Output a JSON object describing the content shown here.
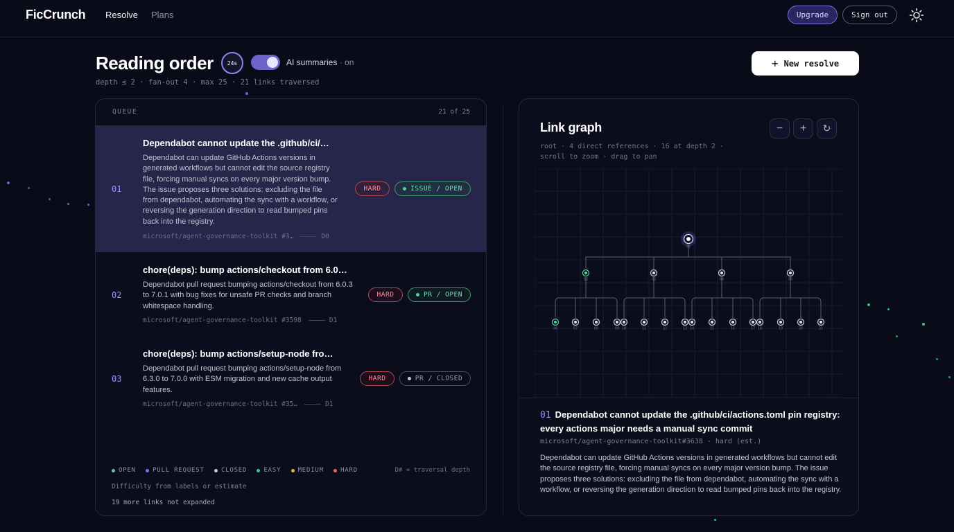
{
  "nav": {
    "brand": "FicCrunch",
    "links": [
      "Resolve",
      "Plans"
    ],
    "upgrade_label": "Upgrade",
    "signout_label": "Sign out"
  },
  "header": {
    "title": "Reading order",
    "timer": "24s",
    "ai_label": "AI summaries",
    "ai_state": "· on",
    "meta": "depth ≤ 2 · fan-out 4 · max 25 · 21 links traversed",
    "new_resolve_label": "New resolve"
  },
  "queue": {
    "heading": "QUEUE",
    "count": "21 of 25",
    "items": [
      {
        "num": "01",
        "title": "Dependabot cannot update the .github/ci/…",
        "desc": "Dependabot can update GitHub Actions versions in generated workflows but cannot edit the source registry file, forcing manual syncs on every major version bump. The issue proposes three solutions: excluding the file from dependabot, automating the sync with a workflow, or reversing the generation direction to read bumped pins back into the registry.",
        "ref": "microsoft/agent-governance-toolkit #3…",
        "depth": "D0",
        "difficulty": "HARD",
        "status": "ISSUE / OPEN"
      },
      {
        "num": "02",
        "title": "chore(deps): bump actions/checkout from 6.0…",
        "desc": "Dependabot pull request bumping actions/checkout from 6.0.3 to 7.0.1 with bug fixes for unsafe PR checks and branch whitespace handling.",
        "ref": "microsoft/agent-governance-toolkit #3598",
        "depth": "D1",
        "difficulty": "HARD",
        "status": "PR / OPEN"
      },
      {
        "num": "03",
        "title": "chore(deps): bump actions/setup-node fro…",
        "desc": "Dependabot pull request bumping actions/setup-node from 6.3.0 to 7.0.0 with ESM migration and new cache output features.",
        "ref": "microsoft/agent-governance-toolkit #35…",
        "depth": "D1",
        "difficulty": "HARD",
        "status": "PR / CLOSED"
      }
    ],
    "legend": [
      "OPEN",
      "PULL REQUEST",
      "CLOSED",
      "EASY",
      "MEDIUM",
      "HARD"
    ],
    "legend_depth": "D# = traversal depth",
    "legend_note": "Difficulty from labels or estimate",
    "legend_more": "19 more links not expanded"
  },
  "graph": {
    "title": "Link graph",
    "meta_line1": "root · 4 direct references · 16 at depth 2 ·",
    "meta_line2": "scroll to zoom · drag to pan",
    "zoom_out": "−",
    "zoom_in": "+",
    "reset_icon": "↻",
    "root_label": "01",
    "level1_labels": [
      "02",
      "03",
      "04",
      "05"
    ],
    "level2_labels": [
      "06",
      "07",
      "08",
      "09",
      "10",
      "11",
      "12",
      "13",
      "14",
      "15",
      "16",
      "17",
      "18",
      "19",
      "20",
      "21"
    ],
    "detail": {
      "num": "01",
      "title": "Dependabot cannot update the .github/ci/actions.toml pin registry: every actions major needs a manual sync commit",
      "ref": "microsoft/agent-governance-toolkit#3638 · hard (est.)",
      "desc": "Dependabot can update GitHub Actions versions in generated workflows but cannot edit the source registry file, forcing manual syncs on every major version bump. The issue proposes three solutions: excluding the file from dependabot, automating the sync with a workflow, or reversing the generation direction to read bumped pins back into the registry."
    }
  },
  "colors": {
    "accent": "#9a90ff",
    "open": "#4fd19a",
    "pull_request": "#7c72f0",
    "closed": "#c9cad6",
    "easy": "#34c98e",
    "medium": "#e8b24a",
    "hard": "#ef5f66"
  }
}
